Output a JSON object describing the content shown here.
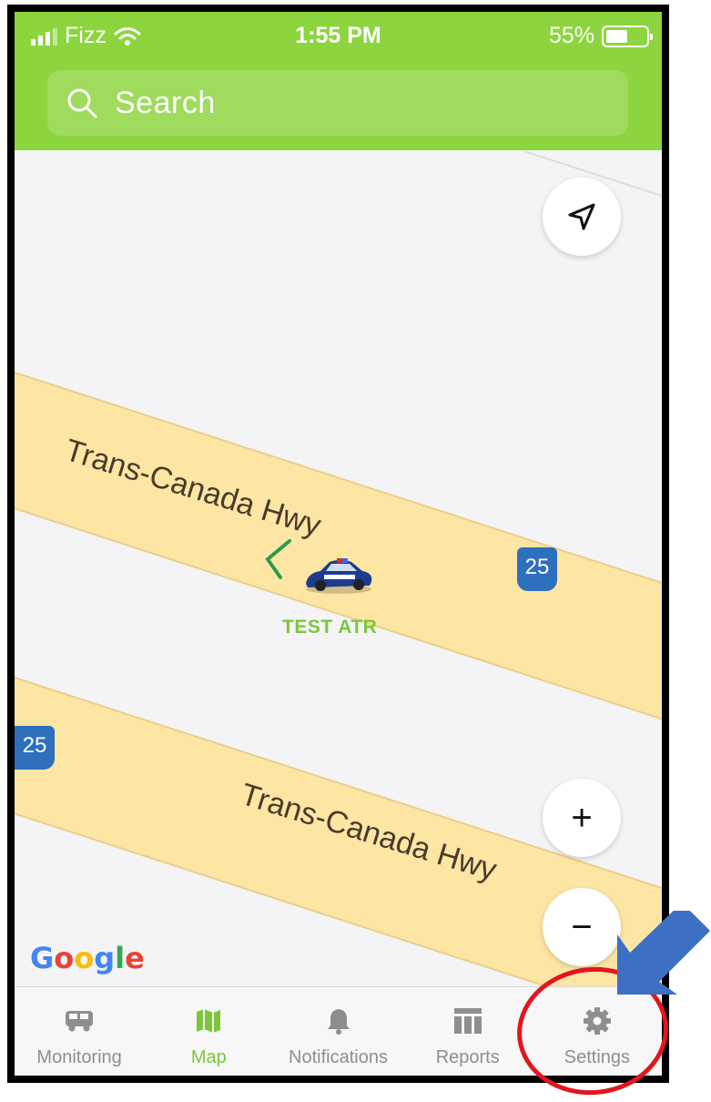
{
  "status_bar": {
    "carrier": "Fizz",
    "time": "1:55 PM",
    "battery_percent": "55%",
    "battery_level": 0.55
  },
  "search": {
    "placeholder": "Search"
  },
  "map": {
    "roads": [
      {
        "name": "Trans-Canada Hwy",
        "route_shield": "25"
      },
      {
        "name": "Trans-Canada Hwy",
        "route_shield": "25"
      }
    ],
    "vehicle": {
      "label": "TEST ATR",
      "icon": "police-car-icon",
      "heading_icon": "chevron-left-icon"
    },
    "attribution": "Google",
    "controls": {
      "locate_icon": "navigation-arrow-icon",
      "zoom_in": "+",
      "zoom_out": "−"
    }
  },
  "tabs": [
    {
      "label": "Monitoring",
      "icon": "bus-icon",
      "active": false
    },
    {
      "label": "Map",
      "icon": "map-icon",
      "active": true
    },
    {
      "label": "Notifications",
      "icon": "bell-icon",
      "active": false
    },
    {
      "label": "Reports",
      "icon": "table-icon",
      "active": false
    },
    {
      "label": "Settings",
      "icon": "gear-icon",
      "active": false
    }
  ],
  "colors": {
    "header": "#8dd53f",
    "accent": "#7dc63b",
    "road": "#fde6a4",
    "shield": "#2e6fbe",
    "annotation": "#e3151d",
    "arrow": "#3d6fc4"
  }
}
